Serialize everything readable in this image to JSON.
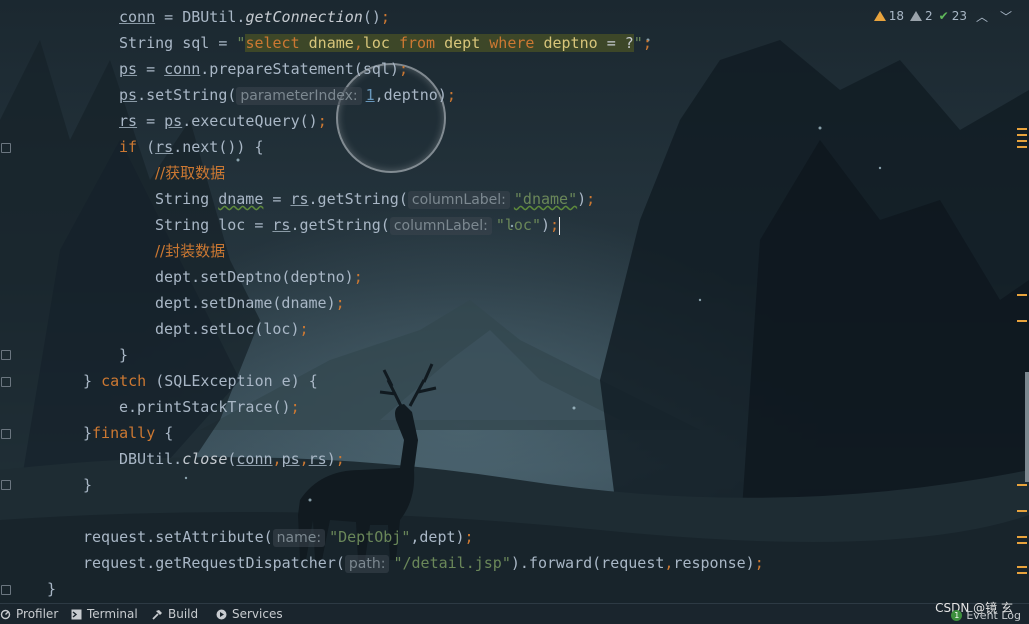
{
  "inspections": {
    "warnings": "18",
    "weak_warnings": "2",
    "typos": "23"
  },
  "code": {
    "l1": {
      "a": "conn",
      "b": " = DBUtil.",
      "c": "getConnection",
      "d": "()",
      "e": ";"
    },
    "l2": {
      "a": "String sql = ",
      "q1": "\"",
      "s1": "select ",
      "s2": "dname",
      "s3": ",",
      "s4": "loc ",
      "s5": "from ",
      "s6": "dept ",
      "s7": "where ",
      "s8": "deptno ",
      "s9": "= ?",
      "q2": "\"",
      "e": ";"
    },
    "l3": {
      "a": "ps",
      "b": " = ",
      "c": "conn",
      "d": ".prepareStatement(sql)",
      "e": ";"
    },
    "l4": {
      "a": "ps",
      "b": ".setString(",
      "hint": "parameterIndex:",
      "num": "1",
      "c": ",deptno)",
      "e": ";"
    },
    "l5": {
      "a": "rs",
      "b": " = ",
      "c": "ps",
      "d": ".executeQuery()",
      "e": ";"
    },
    "l6": {
      "kw": "if",
      "a": " (",
      "b": "rs",
      "c": ".next()) {"
    },
    "l7": {
      "comment": "//获取数据"
    },
    "l8": {
      "a": "String ",
      "b": "dname",
      "c": " = ",
      "d": "rs",
      "e": ".getString(",
      "hint": "columnLabel:",
      "s": "\"dname\"",
      "f": ")",
      "g": ";"
    },
    "l9": {
      "a": "String loc = ",
      "d": "rs",
      "e": ".getString(",
      "hint": "columnLabel:",
      "s": "\"loc\"",
      "f": ")",
      "g": ";"
    },
    "l10": {
      "comment": "//封装数据"
    },
    "l11": {
      "a": "dept.setDeptno(deptno)",
      "e": ";"
    },
    "l12": {
      "a": "dept.setDname(dname)",
      "e": ";"
    },
    "l13": {
      "a": "dept.setLoc(loc)",
      "e": ";"
    },
    "l14": {
      "a": "}"
    },
    "l15": {
      "a": "} ",
      "kw": "catch",
      "b": " (SQLException e) {"
    },
    "l16": {
      "a": "e.printStackTrace()",
      "e": ";"
    },
    "l17": {
      "a": "}",
      "kw": "finally",
      "b": " {"
    },
    "l18": {
      "a": "DBUtil.",
      "fn": "close",
      "b": "(",
      "c": "conn",
      "s1": ",",
      "d": "ps",
      "s2": ",",
      "f": "rs",
      "g": ")",
      "e": ";"
    },
    "l19": {
      "a": "}"
    },
    "l20": {
      "a": "request.setAttribute(",
      "hint": "name:",
      "s": "\"DeptObj\"",
      "b": ",dept)",
      "e": ";"
    },
    "l21": {
      "a": "request.getRequestDispatcher(",
      "hint": "path:",
      "s": "\"/detail.jsp\"",
      "b": ").forward(request",
      "c": ",",
      "d": "response)",
      "e": ";"
    },
    "l22": {
      "a": "}"
    }
  },
  "statusbar": {
    "profiler": "Profiler",
    "terminal": "Terminal",
    "build": "Build",
    "services": "Services",
    "event_log": "Event Log",
    "event_count": "1",
    "watermark": "CSDN @镜 玄"
  },
  "colors": {
    "keyword": "#cc7832",
    "string": "#6a8759",
    "text": "#a9b7c6",
    "warning": "#e8a33d"
  }
}
